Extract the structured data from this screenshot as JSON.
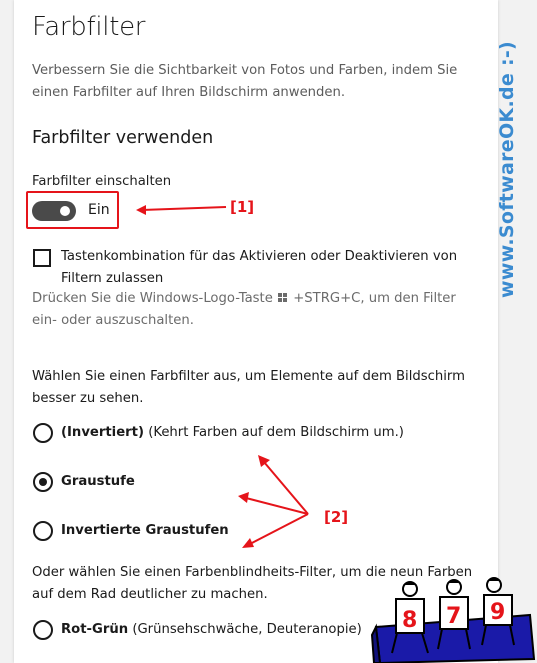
{
  "page": {
    "title": "Farbfilter",
    "description": "Verbessern Sie die Sichtbarkeit von Fotos und Farben, indem Sie einen Farbfilter auf Ihren Bildschirm anwenden.",
    "section_title": "Farbfilter verwenden"
  },
  "toggle": {
    "label": "Farbfilter einschalten",
    "state_text": "Ein",
    "on": true
  },
  "shortcut": {
    "checkbox_label": "Tastenkombination für das Aktivieren oder Deaktivieren von Filtern zulassen",
    "checked": false,
    "hint_before": "Drücken Sie die Windows-Logo-Taste",
    "hint_after": "+STRG+C, um den Filter ein- oder auszuschalten."
  },
  "filters": {
    "intro": "Wählen Sie einen Farbfilter aus, um Elemente auf dem Bildschirm besser zu sehen.",
    "options": [
      {
        "name": "(Invertiert)",
        "detail": "(Kehrt Farben auf dem Bildschirm um.)",
        "selected": false
      },
      {
        "name": "Graustufe",
        "detail": "",
        "selected": true
      },
      {
        "name": "Invertierte Graustufen",
        "detail": "",
        "selected": false
      }
    ]
  },
  "colorblind": {
    "intro": "Oder wählen Sie einen Farbenblindheits-Filter, um die neun Farben auf dem Rad deutlicher zu machen.",
    "options": [
      {
        "name": "Rot-Grün",
        "detail": "(Grünsehschwäche, Deuteranopie)",
        "selected": false
      }
    ]
  },
  "annotations": {
    "a1": "[1]",
    "a2": "[2]"
  },
  "watermark": "www.SoftwareOK.de :-)",
  "mascot_numbers": [
    "8",
    "7",
    "9"
  ],
  "colors": {
    "accent_red": "#e5141a",
    "toggle_on": "#4a4a4a",
    "watermark_blue": "#3b8bd0",
    "mascot_blue": "#1a1aa8"
  }
}
